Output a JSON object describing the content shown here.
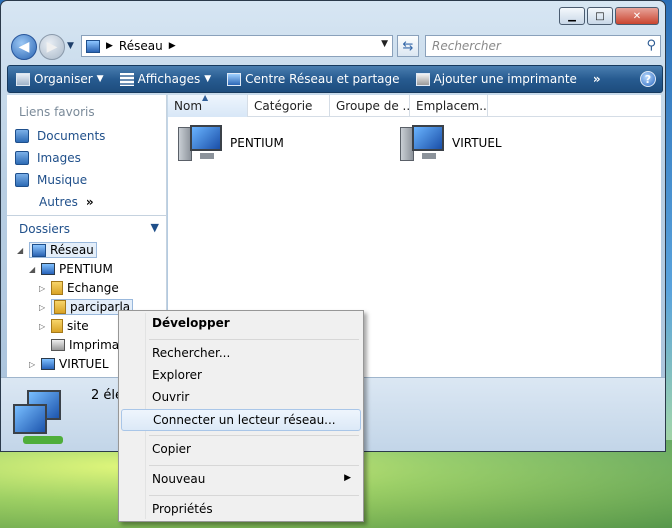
{
  "address": {
    "location": "Réseau"
  },
  "search": {
    "placeholder": "Rechercher"
  },
  "toolbar": {
    "organiser": "Organiser",
    "affichages": "Affichages",
    "centre": "Centre Réseau et partage",
    "imprimante": "Ajouter une imprimante",
    "more": "»"
  },
  "favorites": {
    "heading": "Liens favoris",
    "items": [
      "Documents",
      "Images",
      "Musique"
    ],
    "more_label": "Autres",
    "more_arrow": "»"
  },
  "folders": {
    "heading": "Dossiers",
    "tree": [
      "Réseau",
      "PENTIUM",
      "Echange",
      "parciparla",
      "site",
      "Imprimar",
      "VIRTUEL"
    ]
  },
  "columns": [
    "Nom",
    "Catégorie",
    "Groupe de ...",
    "Emplacem..."
  ],
  "computers": [
    "PENTIUM",
    "VIRTUEL"
  ],
  "status": {
    "text": "2 élé"
  },
  "context_menu": {
    "items": [
      "Développer",
      "Rechercher...",
      "Explorer",
      "Ouvrir",
      "Connecter un lecteur réseau...",
      "Copier",
      "Nouveau",
      "Propriétés"
    ]
  }
}
